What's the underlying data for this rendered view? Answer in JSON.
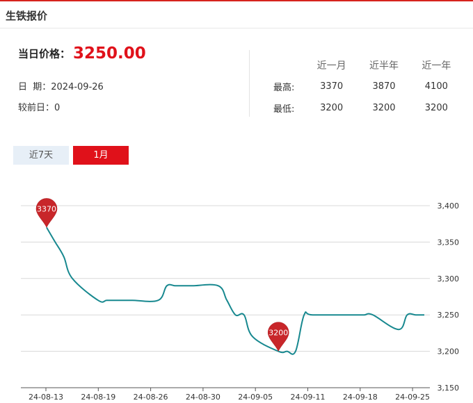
{
  "header": {
    "title": "生铁报价"
  },
  "price": {
    "label": "当日价格：",
    "value": "3250.00",
    "date_label": "日  期：",
    "date": "2024-09-26",
    "change_label": "较前日：",
    "change": "0"
  },
  "stats": {
    "columns": [
      "近一月",
      "近半年",
      "近一年"
    ],
    "rows": [
      {
        "label": "最高:",
        "values": [
          "3370",
          "3870",
          "4100"
        ]
      },
      {
        "label": "最低:",
        "values": [
          "3200",
          "3200",
          "3200"
        ]
      }
    ]
  },
  "tabs": [
    {
      "label": "近7天",
      "active": false
    },
    {
      "label": "1月",
      "active": true
    }
  ],
  "colors": {
    "accent": "#e0111a",
    "line": "#17888f",
    "pin": "#c8262a",
    "tab_inactive_bg": "#e7eff7"
  },
  "chart_data": {
    "type": "line",
    "x_tick_labels": [
      "24-08-13",
      "24-08-19",
      "24-08-26",
      "24-08-30",
      "24-09-05",
      "24-09-11",
      "24-09-18",
      "24-09-25"
    ],
    "ylim": [
      3150,
      3400
    ],
    "y_ticks": [
      3150,
      3200,
      3250,
      3300,
      3350,
      3400
    ],
    "y_tick_labels": [
      "3,150",
      "3,200",
      "3,250",
      "3,300",
      "3,350",
      "3,400"
    ],
    "grid": true,
    "series": [
      {
        "x": [
          "2024-08-13",
          "2024-08-14",
          "2024-08-15",
          "2024-08-16",
          "2024-08-19",
          "2024-08-20",
          "2024-08-21",
          "2024-08-22",
          "2024-08-23",
          "2024-08-26",
          "2024-08-27",
          "2024-08-28",
          "2024-08-29",
          "2024-08-30",
          "2024-09-02",
          "2024-09-03",
          "2024-09-04",
          "2024-09-05",
          "2024-09-06",
          "2024-09-09",
          "2024-09-10",
          "2024-09-11",
          "2024-09-12",
          "2024-09-13",
          "2024-09-18",
          "2024-09-19",
          "2024-09-20",
          "2024-09-23",
          "2024-09-24",
          "2024-09-25",
          "2024-09-26"
        ],
        "values": [
          3370,
          3350,
          3330,
          3300,
          3270,
          3270,
          3270,
          3270,
          3270,
          3270,
          3290,
          3290,
          3290,
          3290,
          3290,
          3270,
          3250,
          3250,
          3220,
          3200,
          3200,
          3200,
          3250,
          3250,
          3250,
          3250,
          3250,
          3230,
          3250,
          3250,
          3250
        ]
      }
    ],
    "annotations": [
      {
        "label": "3370",
        "date": "2024-08-13",
        "value": 3370
      },
      {
        "label": "3200",
        "date": "2024-09-09",
        "value": 3200
      }
    ]
  }
}
